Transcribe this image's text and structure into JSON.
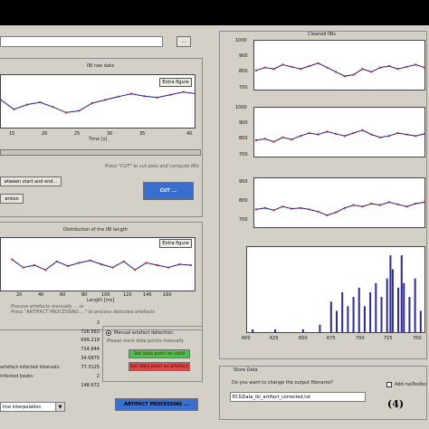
{
  "colors": {
    "window": "#d4d0c8",
    "line_blue": "#1a1a90",
    "marker_red": "#d02020",
    "bar_blue": "#2a2a9e",
    "btn_green": "#4fc04f",
    "btn_red": "#e04848",
    "btn_blue": "#3a6fd0"
  },
  "icons": [
    "browse-dots-icon",
    "chevron-down-icon",
    "radio-selected-icon",
    "checkbox-icon"
  ],
  "browse_label": "...",
  "raw": {
    "title": "IBI raw data",
    "extra": "Extra figure",
    "xlabel": "Time [s]",
    "x_ticks": [
      "15",
      "20",
      "25",
      "30",
      "35",
      "40"
    ],
    "note": "Press \"CUT\" to cut data and compute IBIs",
    "between_btn": "etween start and end...",
    "version_btn": "ersion",
    "cut_btn": "CUT ..."
  },
  "dist": {
    "title": "Distribution of the IBI length",
    "extra": "Extra figure",
    "xlabel": "Length [ms]",
    "x_ticks": [
      "20",
      "40",
      "60",
      "80",
      "100",
      "120",
      "140",
      "160"
    ],
    "note1": "Process artefacts manually ... or",
    "note2": "Press \"ARTIFACT PROCESSING ...\" to process detected artefacts"
  },
  "artefact": {
    "count": "2",
    "values": [
      "726.563",
      "699.219",
      "714.844",
      "34.6875",
      "77.3125",
      "2",
      "148.672"
    ],
    "label_intervals": "artefact-infected intervals:",
    "label_beats": "infected beats:",
    "manual_label": "Manual artefact detection:",
    "manual_note": "Please mark data points manually",
    "valid_btn": "Set data point as valid",
    "artefact_btn": "Set data point as artefact",
    "method": "line interpolation",
    "process_btn": "ARTIFACT PROCESSING ..."
  },
  "cleaned": {
    "title": "Cleaned IBIs",
    "p1_ticks": [
      "1000",
      "900",
      "800",
      "700"
    ],
    "p2_ticks": [
      "1000",
      "900",
      "800",
      "700"
    ],
    "p3_ticks": [
      "900",
      "800",
      "700"
    ]
  },
  "hist": {
    "x_ticks": [
      "600",
      "625",
      "650",
      "675",
      "700",
      "725",
      "750"
    ]
  },
  "store": {
    "title": "Store Data",
    "question": "Do you want to change the output filename?",
    "filename": "ECGData_ibi_artifact_corrected.txt",
    "checkbox_label": "Add rsaToolbo",
    "step": "(4)"
  },
  "chart_data": [
    {
      "type": "line",
      "title": "IBI raw data",
      "xlabel": "Time [s]",
      "x": [
        10,
        12,
        14,
        16,
        18,
        20,
        22,
        24,
        26,
        28,
        30,
        32,
        34,
        36,
        38,
        40
      ],
      "values": [
        0.55,
        0.35,
        0.45,
        0.5,
        0.4,
        0.28,
        0.32,
        0.48,
        0.55,
        0.62,
        0.68,
        0.63,
        0.6,
        0.66,
        0.72,
        0.68
      ],
      "xlim": [
        10,
        40
      ]
    },
    {
      "type": "line",
      "title": "Distribution of the IBI length",
      "xlabel": "Length [ms]",
      "x": [
        10,
        20,
        30,
        40,
        50,
        60,
        70,
        80,
        90,
        100,
        110,
        120,
        130,
        140,
        150,
        160,
        170
      ],
      "values": [
        0.62,
        0.45,
        0.5,
        0.4,
        0.58,
        0.48,
        0.55,
        0.6,
        0.52,
        0.45,
        0.58,
        0.4,
        0.55,
        0.5,
        0.45,
        0.52,
        0.5
      ],
      "xlim": [
        0,
        175
      ]
    },
    {
      "type": "line",
      "title": "Cleaned IBIs",
      "values": [
        820,
        840,
        830,
        860,
        845,
        830,
        850,
        870,
        840,
        810,
        780,
        790,
        830,
        810,
        840,
        850,
        830,
        845,
        860,
        840
      ],
      "ylim": [
        700,
        1000
      ]
    },
    {
      "type": "line",
      "values": [
        800,
        810,
        790,
        820,
        805,
        830,
        850,
        840,
        860,
        845,
        830,
        850,
        870,
        840,
        820,
        830,
        850,
        840,
        830,
        845
      ],
      "ylim": [
        700,
        1000
      ]
    },
    {
      "type": "line",
      "values": [
        760,
        770,
        755,
        780,
        765,
        770,
        760,
        745,
        720,
        740,
        770,
        790,
        780,
        800,
        790,
        810,
        795,
        780,
        800,
        810
      ],
      "ylim": [
        650,
        950
      ]
    },
    {
      "type": "bar",
      "x": [
        605,
        625,
        650,
        665,
        675,
        680,
        685,
        690,
        695,
        700,
        705,
        710,
        715,
        720,
        725,
        728,
        730,
        735,
        738,
        740,
        745,
        750,
        755
      ],
      "values": [
        1,
        1,
        1,
        2,
        7,
        5,
        9,
        6,
        8,
        10,
        6,
        9,
        11,
        8,
        12,
        17,
        14,
        10,
        17,
        11,
        8,
        12,
        5
      ],
      "xlim": [
        600,
        760
      ],
      "ylim": [
        0,
        18
      ]
    }
  ]
}
